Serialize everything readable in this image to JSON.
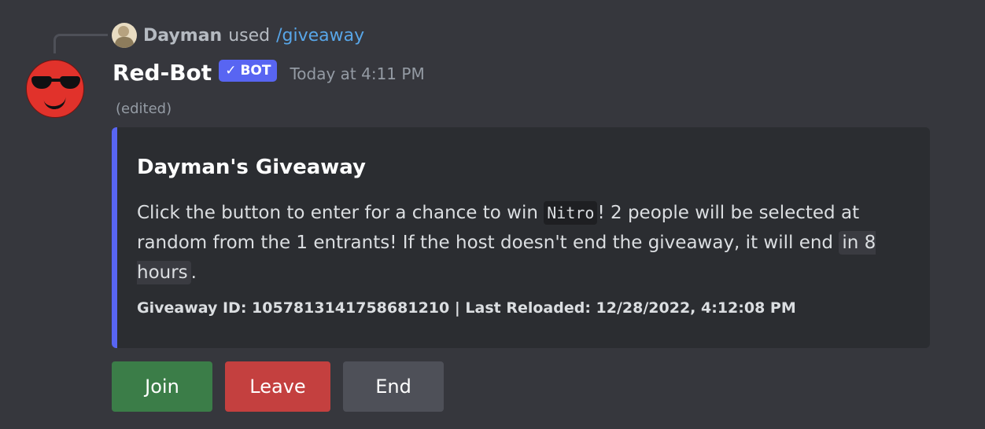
{
  "reply": {
    "user": "Dayman",
    "used": "used",
    "command": "/giveaway"
  },
  "message": {
    "author": "Red-Bot",
    "bot_badge": "BOT",
    "timestamp": "Today at 4:11 PM",
    "edited": "(edited)"
  },
  "embed": {
    "title": "Dayman's Giveaway",
    "desc_part1": "Click the button to enter for a chance to win ",
    "prize": "Nitro",
    "desc_part2": "! 2 people will be selected at random from the 1 entrants! If the host doesn't end the giveaway, it will end ",
    "end_time": "in 8 hours",
    "desc_part3": ".",
    "footer": "Giveaway ID: 1057813141758681210 | Last Reloaded: 12/28/2022, 4:12:08 PM",
    "accent_color": "#5865f2"
  },
  "buttons": {
    "join": "Join",
    "leave": "Leave",
    "end": "End"
  },
  "colors": {
    "join": "#3b7d48",
    "leave": "#c4403f",
    "end": "#4e5058",
    "link": "#58a6e8"
  }
}
